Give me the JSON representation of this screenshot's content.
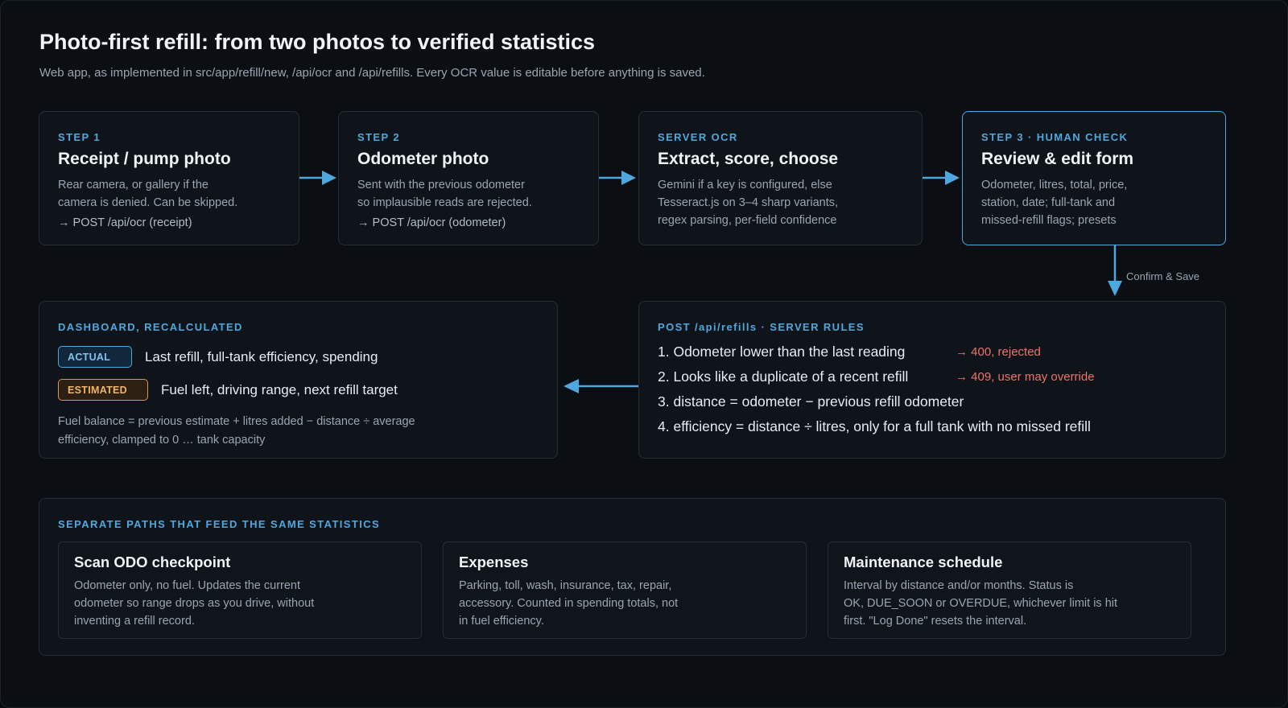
{
  "header": {
    "title": "Photo-first refill: from two photos to verified statistics",
    "subtitle": "Web app, as implemented in src/app/refill/new, /api/ocr and /api/refills. Every OCR value is editable before anything is saved."
  },
  "steps": [
    {
      "label": "STEP 1",
      "title": "Receipt / pump photo",
      "desc": [
        "Rear camera, or gallery if the",
        "camera is denied. Can be skipped."
      ],
      "call": "→ POST /api/ocr (receipt)"
    },
    {
      "label": "STEP 2",
      "title": "Odometer photo",
      "desc": [
        "Sent with the previous odometer",
        "so implausible reads are rejected."
      ],
      "call": "→ POST /api/ocr (odometer)"
    },
    {
      "label": "SERVER OCR",
      "title": "Extract, score, choose",
      "desc": [
        "Gemini if a key is configured, else",
        "Tesseract.js on 3–4 sharp variants,",
        "regex parsing, per-field confidence"
      ]
    },
    {
      "label": "STEP 3 · HUMAN CHECK",
      "title": "Review & edit form",
      "desc": [
        "Odometer, litres, total, price,",
        "station, date; full-tank and",
        "missed-refill flags; presets"
      ]
    }
  ],
  "confirm_label": "Confirm & Save",
  "dashboard": {
    "label": "DASHBOARD, RECALCULATED",
    "actual_badge": "ACTUAL",
    "actual_text": "Last refill, full-tank efficiency, spending",
    "estimated_badge": "ESTIMATED",
    "estimated_text": "Fuel left, driving range, next refill target",
    "note": [
      "Fuel balance = previous estimate + litres added − distance ÷ average",
      "efficiency, clamped to 0 … tank capacity"
    ]
  },
  "rules": {
    "label": "POST /api/refills · SERVER RULES",
    "items": [
      {
        "text": "1. Odometer lower than the last reading",
        "result": "→ 400, rejected"
      },
      {
        "text": "2. Looks like a duplicate of a recent refill",
        "result": "→ 409, user may override"
      },
      {
        "text": "3. distance = odometer − previous refill odometer"
      },
      {
        "text": "4. efficiency = distance ÷ litres, only for a full tank with no missed refill"
      }
    ]
  },
  "paths": {
    "label": "SEPARATE PATHS THAT FEED THE SAME STATISTICS",
    "items": [
      {
        "title": "Scan ODO checkpoint",
        "desc": [
          "Odometer only, no fuel. Updates the current",
          "odometer so range drops as you drive, without",
          "inventing a refill record."
        ]
      },
      {
        "title": "Expenses",
        "desc": [
          "Parking, toll, wash, insurance, tax, repair,",
          "accessory. Counted in spending totals, not",
          "in fuel efficiency."
        ]
      },
      {
        "title": "Maintenance schedule",
        "desc": [
          "Interval by distance and/or months. Status is",
          "OK, DUE_SOON or OVERDUE, whichever limit is hit",
          "first. \"Log Done\" resets the interval."
        ]
      }
    ]
  },
  "colors": {
    "background": "#0b0f14",
    "accent": "#4ea8de",
    "estimated": "#f0b566",
    "error": "#f0716b"
  }
}
